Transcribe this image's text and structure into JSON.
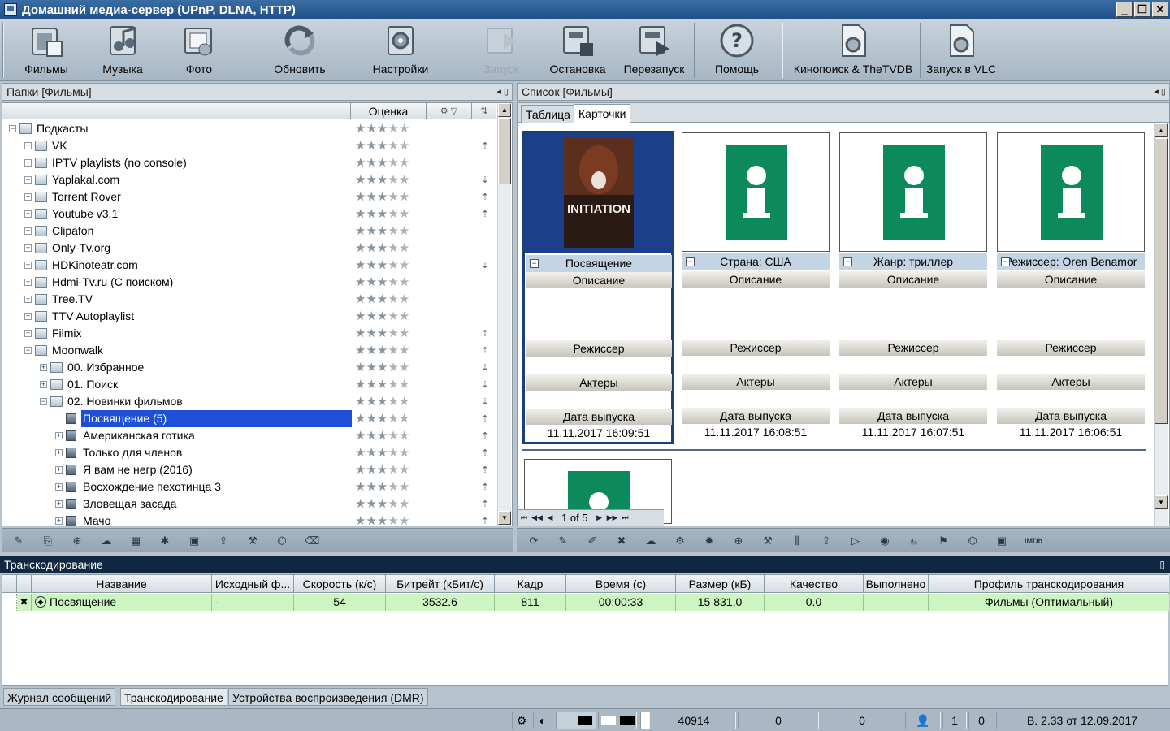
{
  "window": {
    "title": "Домашний медиа-сервер (UPnP, DLNA, HTTP)",
    "minimize": "_",
    "restore": "❐",
    "close": "✕"
  },
  "toolbar": {
    "buttons": [
      {
        "label": "Фильмы",
        "icon": "film-icon"
      },
      {
        "label": "Музыка",
        "icon": "music-icon"
      },
      {
        "label": "Фото",
        "icon": "photo-icon"
      },
      {
        "label": "Обновить",
        "icon": "refresh-icon"
      },
      {
        "label": "Настройки",
        "icon": "settings-icon"
      },
      {
        "label": "Запуск",
        "icon": "start-icon",
        "disabled": true
      },
      {
        "label": "Остановка",
        "icon": "stop-icon"
      },
      {
        "label": "Перезапуск",
        "icon": "restart-icon"
      },
      {
        "label": "Помощь",
        "icon": "help-icon"
      },
      {
        "label": "Кинопоиск & TheTVDB",
        "icon": "gear-doc-icon"
      },
      {
        "label": "Запуск в VLC",
        "icon": "gear-doc-icon"
      }
    ]
  },
  "left": {
    "title": "Папки [Фильмы]",
    "pin": "◂ ▯",
    "col_rating": "Оценка",
    "tree": [
      {
        "label": "Подкасты",
        "exp": "−"
      },
      {
        "label": "VK",
        "exp": "+",
        "act": "⇡"
      },
      {
        "label": "IPTV playlists (no console)",
        "exp": "+"
      },
      {
        "label": "Yaplakal.com",
        "exp": "+",
        "act": "⇣"
      },
      {
        "label": "Torrent Rover",
        "exp": "+",
        "act": "⇡"
      },
      {
        "label": "Youtube v3.1",
        "exp": "+",
        "act": "⇡"
      },
      {
        "label": "Clipafon",
        "exp": "+"
      },
      {
        "label": "Only-Tv.org",
        "exp": "+"
      },
      {
        "label": "HDKinoteatr.com",
        "exp": "+",
        "act": "⇣"
      },
      {
        "label": "Hdmi-Tv.ru (С поиском)",
        "exp": "+"
      },
      {
        "label": "Tree.TV",
        "exp": "+"
      },
      {
        "label": "TTV Autoplaylist",
        "exp": "+"
      },
      {
        "label": "Filmix",
        "exp": "+",
        "act": "⇡"
      },
      {
        "label": "Moonwalk",
        "exp": "−",
        "act": "⇡"
      },
      {
        "label": "00. Избранное",
        "exp": "+",
        "act": "⇣"
      },
      {
        "label": "01. Поиск",
        "exp": "+",
        "act": "⇣"
      },
      {
        "label": "02. Новинки фильмов",
        "exp": "−",
        "act": "⇣"
      },
      {
        "label": "Посвящение (5)",
        "exp": "",
        "act": "⇡",
        "selected": true
      },
      {
        "label": "Американская готика",
        "exp": "+",
        "act": "⇡"
      },
      {
        "label": "Только для членов",
        "exp": "+",
        "act": "⇡"
      },
      {
        "label": "Я вам не негр (2016)",
        "exp": "+",
        "act": "⇡"
      },
      {
        "label": "Восхождение пехотинца 3",
        "exp": "+",
        "act": "⇡"
      },
      {
        "label": "Зловещая засада",
        "exp": "+",
        "act": "⇡"
      },
      {
        "label": "Мачо",
        "exp": "+",
        "act": "⇡"
      }
    ],
    "rating_stars": 3,
    "stars_glyph": "★"
  },
  "right": {
    "title": "Список [Фильмы]",
    "pin": "◂ ▯",
    "tabs": [
      "Таблица",
      "Карточки"
    ],
    "cards": [
      {
        "title": "Посвящение",
        "poster_text": "INITIATION",
        "date": "11.11.2017 16:09:51"
      },
      {
        "title": "Страна: США",
        "date": "11.11.2017 16:08:51"
      },
      {
        "title": "Жанр: триллер",
        "date": "11.11.2017 16:07:51"
      },
      {
        "title": "Режиссер: Oren Benamor",
        "date": "11.11.2017 16:06:51"
      }
    ],
    "sections": [
      "Описание",
      "Режиссер",
      "Актеры",
      "Дата выпуска"
    ],
    "pager": "1 of 5"
  },
  "transcoding": {
    "title": "Транскодирование",
    "pin": "▯",
    "columns": [
      "Название",
      "Исходный ф...",
      "Скорость (к/с)",
      "Битрейт (кБит/с)",
      "Кадр",
      "Время (с)",
      "Размер (кБ)",
      "Качество",
      "Выполнено",
      "Профиль транскодирования"
    ],
    "rows": [
      {
        "name": "Посвящение",
        "source": "-",
        "speed": "54",
        "bitrate": "3532.6",
        "frame": "811",
        "time": "00:00:33",
        "size": "15 831,0",
        "quality": "0.0",
        "done": "",
        "profile": "Фильмы (Оптимальный)"
      }
    ]
  },
  "bottom_tabs": [
    "Журнал сообщений",
    "Транскодирование",
    "Устройства воспроизведения (DMR)"
  ],
  "status": {
    "count": "40914",
    "a": "0",
    "b": "0",
    "c": "1",
    "d": "0",
    "version": "В. 2.33 от 12.09.2017"
  }
}
